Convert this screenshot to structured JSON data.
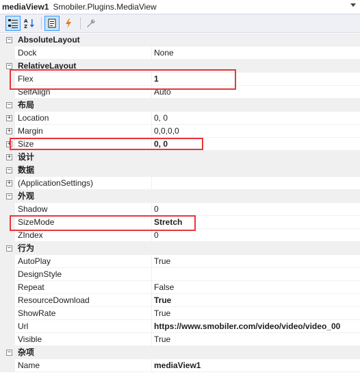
{
  "header": {
    "object_name": "mediaView1",
    "object_type": "Smobiler.Plugins.MediaView"
  },
  "toolbar": {
    "categorized_icon": "categorized-icon",
    "alphabetical_icon": "alphabetical-icon",
    "properties_icon": "properties-icon",
    "events_icon": "events-icon",
    "property_pages_icon": "wrench-icon"
  },
  "rows": [
    {
      "kind": "cat",
      "label": "AbsoluteLayout",
      "exp": "−"
    },
    {
      "kind": "prop",
      "name": "Dock",
      "value": "None"
    },
    {
      "kind": "cat",
      "label": "RelativeLayout",
      "exp": "−"
    },
    {
      "kind": "prop",
      "name": "Flex",
      "value": "1",
      "bold": true
    },
    {
      "kind": "prop",
      "name": "SelfAlign",
      "value": "Auto"
    },
    {
      "kind": "cat",
      "label": "布局",
      "exp": "−"
    },
    {
      "kind": "prop",
      "name": "Location",
      "value": "0, 0",
      "exp": "+"
    },
    {
      "kind": "prop",
      "name": "Margin",
      "value": "0,0,0,0",
      "exp": "+"
    },
    {
      "kind": "prop",
      "name": "Size",
      "value": "0, 0",
      "bold": true,
      "exp": "+"
    },
    {
      "kind": "cat",
      "label": "设计",
      "exp": "+"
    },
    {
      "kind": "cat",
      "label": "数据",
      "exp": "−"
    },
    {
      "kind": "prop",
      "name": "(ApplicationSettings)",
      "value": "",
      "exp": "+"
    },
    {
      "kind": "cat",
      "label": "外观",
      "exp": "−"
    },
    {
      "kind": "prop",
      "name": "Shadow",
      "value": "0"
    },
    {
      "kind": "prop",
      "name": "SizeMode",
      "value": "Stretch",
      "bold": true
    },
    {
      "kind": "prop",
      "name": "ZIndex",
      "value": "0"
    },
    {
      "kind": "cat",
      "label": "行为",
      "exp": "−"
    },
    {
      "kind": "prop",
      "name": "AutoPlay",
      "value": "True"
    },
    {
      "kind": "prop",
      "name": "DesignStyle",
      "value": ""
    },
    {
      "kind": "prop",
      "name": "Repeat",
      "value": "False"
    },
    {
      "kind": "prop",
      "name": "ResourceDownload",
      "value": "True",
      "bold": true
    },
    {
      "kind": "prop",
      "name": "ShowRate",
      "value": "True"
    },
    {
      "kind": "prop",
      "name": "Url",
      "value": "https://www.smobiler.com/video/video/video_00",
      "bold": true
    },
    {
      "kind": "prop",
      "name": "Visible",
      "value": "True"
    },
    {
      "kind": "cat",
      "label": "杂项",
      "exp": "−"
    },
    {
      "kind": "prop",
      "name": "Name",
      "value": "mediaView1",
      "bold": true
    }
  ],
  "highlight_color": "#e8353b"
}
